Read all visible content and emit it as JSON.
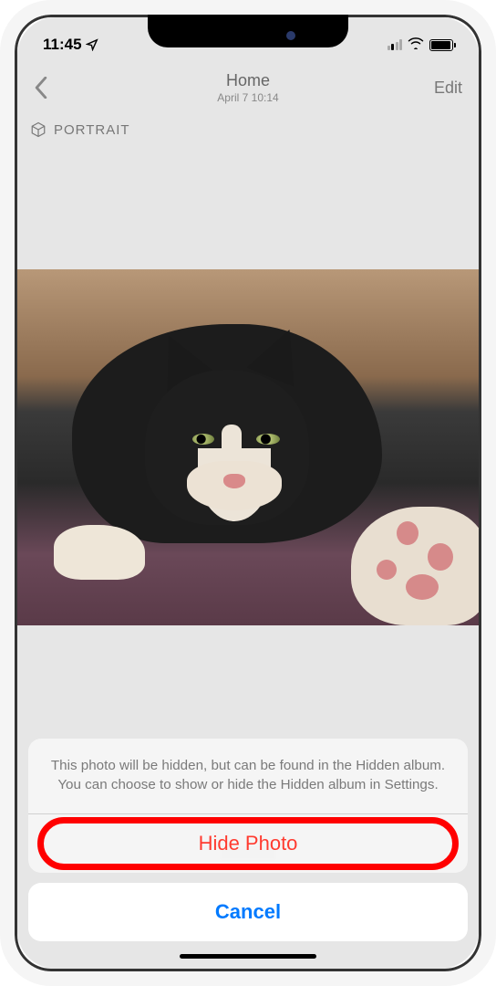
{
  "status": {
    "time": "11:45",
    "location_icon": "location-arrow-icon"
  },
  "nav": {
    "title": "Home",
    "subtitle": "April 7  10:14",
    "edit_label": "Edit"
  },
  "photo": {
    "badge_label": "PORTRAIT"
  },
  "action_sheet": {
    "message": "This photo will be hidden, but can be found in the Hidden album. You can choose to show or hide the Hidden album in Settings.",
    "hide_label": "Hide Photo",
    "cancel_label": "Cancel"
  },
  "colors": {
    "ios_blue": "#007aff",
    "ios_red": "#ff3b30",
    "annotation": "#ff0000"
  }
}
